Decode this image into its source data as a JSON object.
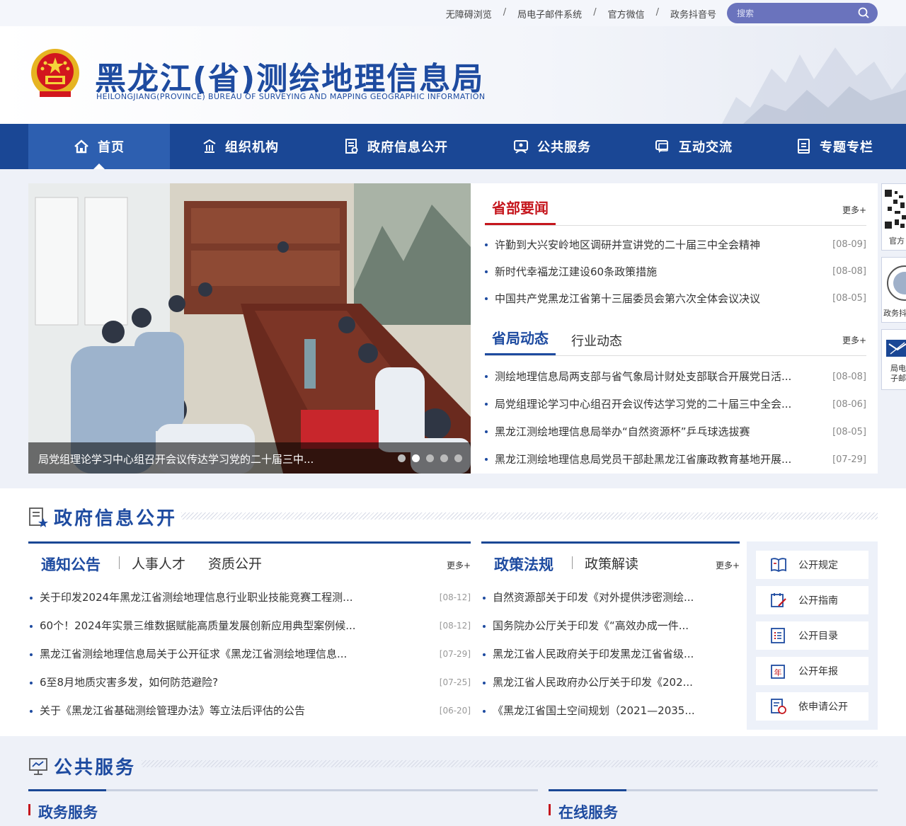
{
  "topbar": {
    "links": [
      "无障碍浏览",
      "局电子邮件系统",
      "官方微信",
      "政务抖音号"
    ],
    "search_placeholder": "搜索"
  },
  "header": {
    "title": "黑龙江(省)测绘地理信息局",
    "subtitle": "HEILONGJIANG(PROVINCE) BUREAU OF SURVEYING AND MAPPING GEOGRAPHIC INFORMATION"
  },
  "nav": {
    "items": [
      {
        "label": "首页",
        "icon": "home-icon"
      },
      {
        "label": "组织机构",
        "icon": "building-icon"
      },
      {
        "label": "政府信息公开",
        "icon": "document-icon"
      },
      {
        "label": "公共服务",
        "icon": "service-icon"
      },
      {
        "label": "互动交流",
        "icon": "chat-icon"
      },
      {
        "label": "专题专栏",
        "icon": "book-icon"
      }
    ]
  },
  "slider": {
    "caption": "局党组理论学习中心组召开会议传达学习党的二十届三中...",
    "active_dot": 2
  },
  "news1": {
    "title": "省部要闻",
    "more": "更多+",
    "items": [
      {
        "text": "许勤到大兴安岭地区调研并宣讲党的二十届三中全会精神",
        "date": "[08-09]"
      },
      {
        "text": "新时代幸福龙江建设60条政策措施",
        "date": "[08-08]"
      },
      {
        "text": "中国共产党黑龙江省第十三届委员会第六次全体会议决议",
        "date": "[08-05]"
      }
    ]
  },
  "news2": {
    "tab_active": "省局动态",
    "tab_other": "行业动态",
    "more": "更多+",
    "items": [
      {
        "text": "测绘地理信息局两支部与省气象局计财处支部联合开展党日活...",
        "date": "[08-08]"
      },
      {
        "text": "局党组理论学习中心组召开会议传达学习党的二十届三中全会...",
        "date": "[08-06]"
      },
      {
        "text": "黑龙江测绘地理信息局举办“自然资源杯”乒乓球选拔赛",
        "date": "[08-05]"
      },
      {
        "text": "黑龙江测绘地理信息局党员干部赴黑龙江省廉政教育基地开展...",
        "date": "[07-29]"
      }
    ]
  },
  "gov_info": {
    "title": "政府信息公开",
    "left_panel": {
      "tabs": [
        "通知公告",
        "人事人才",
        "资质公开"
      ],
      "more": "更多+",
      "items": [
        {
          "text": "关于印发2024年黑龙江省测绘地理信息行业职业技能竞赛工程测...",
          "date": "[08-12]"
        },
        {
          "text": "60个！2024年实景三维数据赋能高质量发展创新应用典型案例候...",
          "date": "[08-12]"
        },
        {
          "text": "黑龙江省测绘地理信息局关于公开征求《黑龙江省测绘地理信息...",
          "date": "[07-29]"
        },
        {
          "text": "6至8月地质灾害多发，如何防范避险?",
          "date": "[07-25]"
        },
        {
          "text": "关于《黑龙江省基础测绘管理办法》等立法后评估的公告",
          "date": "[06-20]"
        }
      ]
    },
    "mid_panel": {
      "tabs": [
        "政策法规",
        "政策解读"
      ],
      "more": "更多+",
      "items": [
        {
          "text": "自然资源部关于印发《对外提供涉密测绘..."
        },
        {
          "text": "国务院办公厅关于印发《“高效办成一件..."
        },
        {
          "text": "黑龙江省人民政府关于印发黑龙江省省级..."
        },
        {
          "text": "黑龙江省人民政府办公厅关于印发《202..."
        },
        {
          "text": "《黑龙江省国土空间规划（2021—2035..."
        }
      ]
    },
    "side_buttons": [
      {
        "label": "公开规定",
        "icon": "book-open-icon"
      },
      {
        "label": "公开指南",
        "icon": "calendar-pen-icon"
      },
      {
        "label": "公开目录",
        "icon": "list-icon"
      },
      {
        "label": "公开年报",
        "icon": "annual-report-icon"
      },
      {
        "label": "依申请公开",
        "icon": "apply-icon"
      }
    ]
  },
  "public_service": {
    "title": "公共服务",
    "left_label": "政务服务",
    "right_label": "在线服务"
  },
  "floating": {
    "items": [
      "官方",
      "政务抖",
      "局电子邮件"
    ]
  },
  "colors": {
    "brand_blue": "#1a4795",
    "accent_red": "#c5161d",
    "bg_light": "#eef1f8"
  }
}
